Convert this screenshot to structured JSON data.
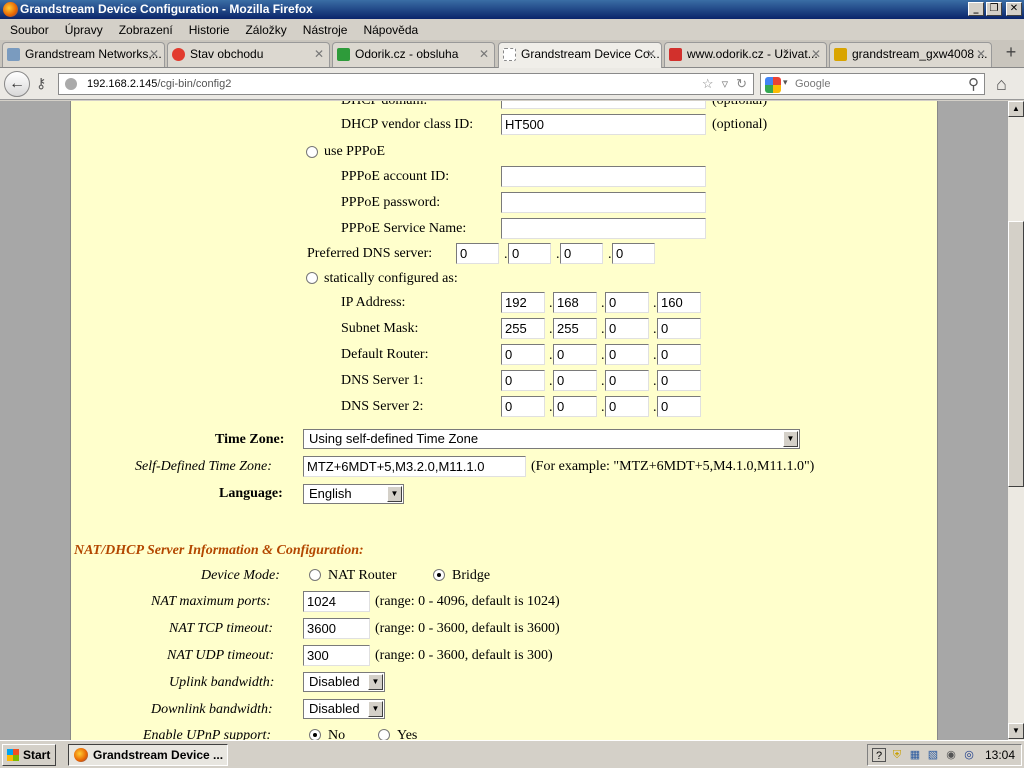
{
  "window": {
    "title": "Grandstream Device Configuration - Mozilla Firefox",
    "min": "_",
    "max": "❐",
    "close": "✕"
  },
  "menu": [
    "Soubor",
    "Úpravy",
    "Zobrazení",
    "Historie",
    "Záložky",
    "Nástroje",
    "Nápověda"
  ],
  "tabs": [
    {
      "label": "Grandstream Networks,...",
      "icon_color": "#7a9bbf"
    },
    {
      "label": "Stav obchodu",
      "icon_color": "#e23b2e"
    },
    {
      "label": "Odorik.cz - obsluha",
      "icon_color": "#2e9b3a"
    },
    {
      "label": "Grandstream Device Co...",
      "icon_color": "#ffffff"
    },
    {
      "label": "www.odorik.cz - Uživat...",
      "icon_color": "#d2302c"
    },
    {
      "label": "grandstream_gxw4008 ...",
      "icon_color": "#d9a400"
    }
  ],
  "nav": {
    "url_host": "192.168.2.145",
    "url_path": "/cgi-bin/config2",
    "search_placeholder": "Google"
  },
  "form": {
    "dhcp_domain_label": "DHCP domain:",
    "dhcp_domain_note": "(optional)",
    "dhcp_vendor_label": "DHCP vendor class ID:",
    "dhcp_vendor_value": "HT500",
    "dhcp_vendor_note": "(optional)",
    "pppoe_radio_label": "use PPPoE",
    "pppoe_account_label": "PPPoE account ID:",
    "pppoe_password_label": "PPPoE password:",
    "pppoe_service_label": "PPPoE Service Name:",
    "pref_dns_label": "Preferred DNS server:",
    "pref_dns": [
      "0",
      "0",
      "0",
      "0"
    ],
    "static_radio_label": "statically configured as:",
    "ip_label": "IP Address:",
    "ip": [
      "192",
      "168",
      "0",
      "160"
    ],
    "mask_label": "Subnet Mask:",
    "mask": [
      "255",
      "255",
      "0",
      "0"
    ],
    "router_label": "Default Router:",
    "router": [
      "0",
      "0",
      "0",
      "0"
    ],
    "dns1_label": "DNS Server 1:",
    "dns1": [
      "0",
      "0",
      "0",
      "0"
    ],
    "dns2_label": "DNS Server 2:",
    "dns2": [
      "0",
      "0",
      "0",
      "0"
    ],
    "tz_label": "Time Zone:",
    "tz_value": "Using self-defined Time Zone",
    "sdtz_label": "Self-Defined Time Zone:",
    "sdtz_value": "MTZ+6MDT+5,M3.2.0,M11.1.0",
    "sdtz_example": "(For example: \"MTZ+6MDT+5,M4.1.0,M11.1.0\")",
    "lang_label": "Language:",
    "lang_value": "English",
    "nat_section": "NAT/DHCP Server Information & Configuration:",
    "device_mode_label": "Device Mode:",
    "nat_router_label": "NAT Router",
    "bridge_label": "Bridge",
    "nat_ports_label": "NAT maximum ports:",
    "nat_ports_value": "1024",
    "nat_ports_note": "(range: 0 - 4096, default is 1024)",
    "tcp_label": "NAT TCP timeout:",
    "tcp_value": "3600",
    "tcp_note": "(range: 0 - 3600, default is 3600)",
    "udp_label": "NAT UDP timeout:",
    "udp_value": "300",
    "udp_note": "(range: 0 - 3600, default is 300)",
    "uplink_label": "Uplink bandwidth:",
    "uplink_value": "Disabled",
    "downlink_label": "Downlink bandwidth:",
    "downlink_value": "Disabled",
    "upnp_label": "Enable UPnP support:",
    "upnp_no": "No",
    "upnp_yes": "Yes"
  },
  "taskbar": {
    "start": "Start",
    "task": "Grandstream Device ...",
    "clock": "13:04"
  }
}
